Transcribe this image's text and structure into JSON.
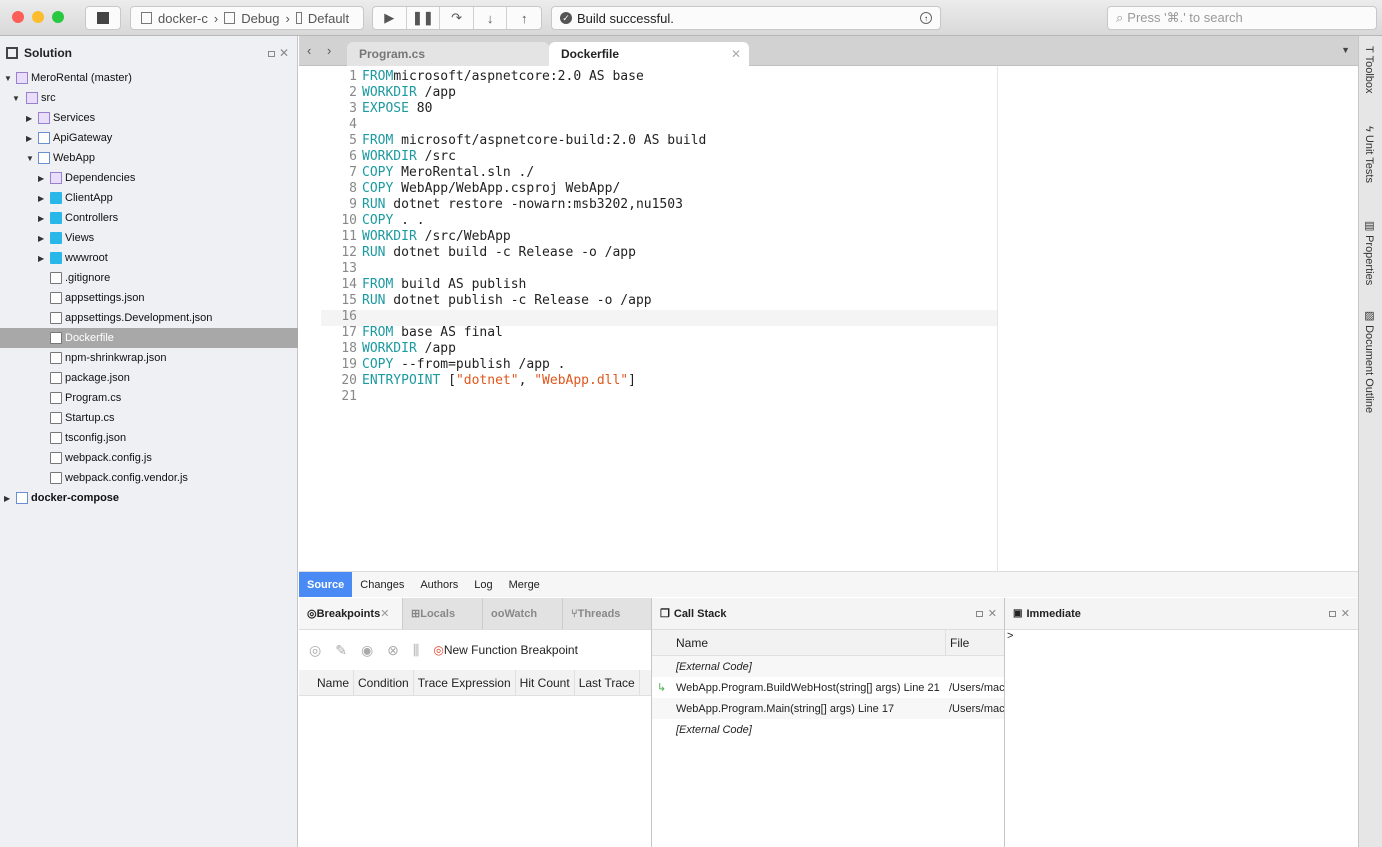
{
  "toolbar": {
    "config_project": "docker-c",
    "config_mode": "Debug",
    "config_device": "Default",
    "status": "Build successful.",
    "search_placeholder": "Press '⌘.' to search"
  },
  "solution": {
    "title": "Solution",
    "items": [
      {
        "label": "MeroRental (master)",
        "level": 0,
        "kind": "sol",
        "arrow": "down"
      },
      {
        "label": "src",
        "level": 1,
        "kind": "sol",
        "arrow": "down"
      },
      {
        "label": "Services",
        "level": 2,
        "kind": "sol",
        "arrow": "right"
      },
      {
        "label": "ApiGateway",
        "level": 2,
        "kind": "proj",
        "arrow": "right"
      },
      {
        "label": "WebApp",
        "level": 2,
        "kind": "proj",
        "arrow": "down"
      },
      {
        "label": "Dependencies",
        "level": 3,
        "kind": "sol",
        "arrow": "right"
      },
      {
        "label": "ClientApp",
        "level": 3,
        "kind": "folder",
        "arrow": "right"
      },
      {
        "label": "Controllers",
        "level": 3,
        "kind": "folder",
        "arrow": "right"
      },
      {
        "label": "Views",
        "level": 3,
        "kind": "folder",
        "arrow": "right"
      },
      {
        "label": "wwwroot",
        "level": 3,
        "kind": "folder",
        "arrow": "right"
      },
      {
        "label": ".gitignore",
        "level": 3,
        "kind": "file",
        "arrow": ""
      },
      {
        "label": "appsettings.json",
        "level": 3,
        "kind": "file",
        "arrow": ""
      },
      {
        "label": "appsettings.Development.json",
        "level": 3,
        "kind": "file",
        "arrow": ""
      },
      {
        "label": "Dockerfile",
        "level": 3,
        "kind": "file",
        "arrow": "",
        "selected": true
      },
      {
        "label": "npm-shrinkwrap.json",
        "level": 3,
        "kind": "file",
        "arrow": ""
      },
      {
        "label": "package.json",
        "level": 3,
        "kind": "file",
        "arrow": ""
      },
      {
        "label": "Program.cs",
        "level": 3,
        "kind": "file",
        "arrow": ""
      },
      {
        "label": "Startup.cs",
        "level": 3,
        "kind": "file",
        "arrow": ""
      },
      {
        "label": "tsconfig.json",
        "level": 3,
        "kind": "file",
        "arrow": ""
      },
      {
        "label": "webpack.config.js",
        "level": 3,
        "kind": "file",
        "arrow": ""
      },
      {
        "label": "webpack.config.vendor.js",
        "level": 3,
        "kind": "file",
        "arrow": ""
      },
      {
        "label": "docker-compose",
        "level": 0,
        "kind": "proj",
        "arrow": "right",
        "bold": true
      }
    ]
  },
  "tabs": [
    {
      "label": "Program.cs",
      "active": false
    },
    {
      "label": "Dockerfile",
      "active": true
    }
  ],
  "code": [
    [
      [
        "kw",
        "FROM"
      ],
      [
        "",
        "microsoft/aspnetcore:2.0 AS base"
      ]
    ],
    [
      [
        "kw",
        "WORKDIR"
      ],
      [
        "",
        " /app"
      ]
    ],
    [
      [
        "kw",
        "EXPOSE"
      ],
      [
        "",
        " 80"
      ]
    ],
    [],
    [
      [
        "kw",
        "FROM"
      ],
      [
        "",
        " microsoft/aspnetcore-build:2.0 AS build"
      ]
    ],
    [
      [
        "kw",
        "WORKDIR"
      ],
      [
        "",
        " /src"
      ]
    ],
    [
      [
        "kw",
        "COPY"
      ],
      [
        "",
        " MeroRental.sln ./"
      ]
    ],
    [
      [
        "kw",
        "COPY"
      ],
      [
        "",
        " WebApp/WebApp.csproj WebApp/"
      ]
    ],
    [
      [
        "kw",
        "RUN"
      ],
      [
        "",
        " dotnet restore -nowarn:msb3202,nu1503"
      ]
    ],
    [
      [
        "kw",
        "COPY"
      ],
      [
        "",
        " . ."
      ]
    ],
    [
      [
        "kw",
        "WORKDIR"
      ],
      [
        "",
        " /src/WebApp"
      ]
    ],
    [
      [
        "kw",
        "RUN"
      ],
      [
        "",
        " dotnet build -c Release -o /app"
      ]
    ],
    [],
    [
      [
        "kw",
        "FROM"
      ],
      [
        "",
        " build AS publish"
      ]
    ],
    [
      [
        "kw",
        "RUN"
      ],
      [
        "",
        " dotnet publish -c Release -o /app"
      ]
    ],
    [],
    [
      [
        "kw",
        "FROM"
      ],
      [
        "",
        " base AS final"
      ]
    ],
    [
      [
        "kw",
        "WORKDIR"
      ],
      [
        "",
        " /app"
      ]
    ],
    [
      [
        "kw",
        "COPY"
      ],
      [
        "",
        " --from=publish /app ."
      ]
    ],
    [
      [
        "kw",
        "ENTRYPOINT"
      ],
      [
        "",
        " ["
      ],
      [
        "str",
        "\"dotnet\""
      ],
      [
        "",
        ", "
      ],
      [
        "str",
        "\"WebApp.dll\""
      ],
      [
        "",
        "]"
      ]
    ],
    []
  ],
  "right_tools": [
    "Toolbox",
    "Unit Tests",
    "Properties",
    "Document Outline"
  ],
  "source_tabs": [
    "Source",
    "Changes",
    "Authors",
    "Log",
    "Merge"
  ],
  "breakpoints": {
    "tabs": [
      "Breakpoints",
      "Locals",
      "Watch",
      "Threads"
    ],
    "new_button": "New Function Breakpoint",
    "columns": [
      "Name",
      "Condition",
      "Trace Expression",
      "Hit Count",
      "Last Trace"
    ]
  },
  "callstack": {
    "title": "Call Stack",
    "columns": [
      "Name",
      "File"
    ],
    "rows": [
      {
        "name": "[External Code]",
        "file": "",
        "external": true
      },
      {
        "name": "WebApp.Program.BuildWebHost(string[] args) Line 21",
        "file": "/Users/mac",
        "current": true
      },
      {
        "name": "WebApp.Program.Main(string[] args) Line 17",
        "file": "/Users/mac"
      },
      {
        "name": "[External Code]",
        "file": "",
        "external": true
      }
    ]
  },
  "immediate": {
    "title": "Immediate",
    "prompt": ">"
  },
  "colors": {
    "accent": "#4a8af4",
    "keyword": "#1b9aa0",
    "string": "#e0561c",
    "folder": "#29b6e8"
  }
}
